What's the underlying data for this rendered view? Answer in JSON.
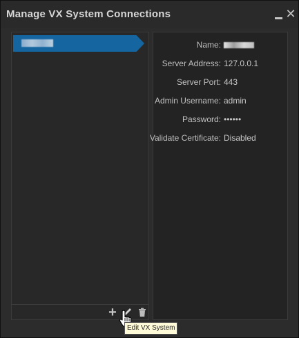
{
  "window": {
    "title": "Manage VX System Connections",
    "minimize_icon": "minimize-icon",
    "close_icon": "close-icon",
    "close_glyph": "✕"
  },
  "connections": {
    "items": [
      {
        "label": "",
        "selected": true
      }
    ]
  },
  "details": {
    "name": {
      "key": "Name:",
      "value": ""
    },
    "server_address": {
      "key": "Server Address:",
      "value": "127.0.0.1"
    },
    "server_port": {
      "key": "Server Port:",
      "value": "443"
    },
    "admin_username": {
      "key": "Admin Username:",
      "value": "admin"
    },
    "password": {
      "key": "Password:",
      "value": "••••••"
    },
    "validate_certificate": {
      "key": "Validate Certificate:",
      "value": "Disabled"
    }
  },
  "toolbar": {
    "add_glyph": "+",
    "add_icon": "plus-icon",
    "edit_icon": "pencil-icon",
    "delete_icon": "trash-icon",
    "tooltip": "Edit VX System"
  },
  "colors": {
    "background": "#2c2c2c",
    "selected_item": "#1565a0",
    "panel": "#232323",
    "text": "#c8c8c8"
  }
}
